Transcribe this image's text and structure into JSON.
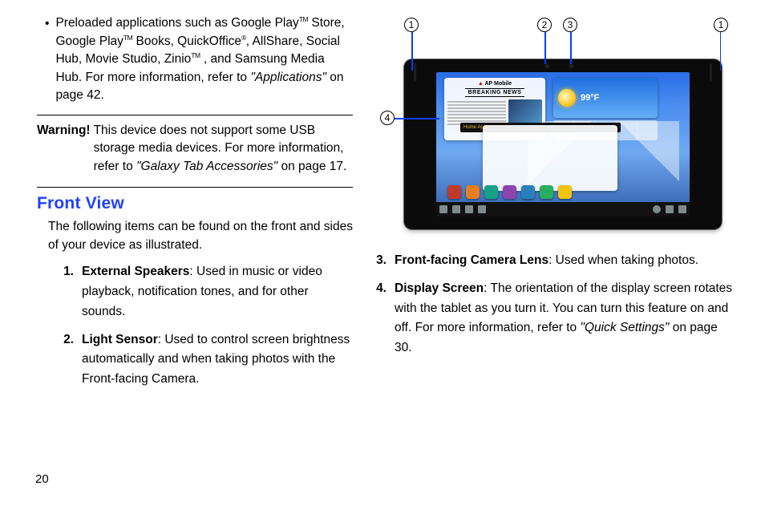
{
  "page_number": "20",
  "bullet": {
    "prefix": "Preloaded applications such as Google Play",
    "tm1": "TM",
    "mid1": " Store, Google Play",
    "tm2": "TM",
    "mid2": " Books, QuickOffice",
    "reg": "®",
    "mid3": ", AllShare, Social Hub, Movie Studio, Zinio",
    "tm3": "TM",
    "suffix": " , and Samsung Media Hub. For more information, refer to ",
    "ref_quote": "\"Applications\"",
    "ref_after": "  on page 42."
  },
  "warning": {
    "label": "Warning!",
    "line": "This device does not support some USB storage media devices. For more information, refer to ",
    "ref_quote": "\"Galaxy Tab Accessories\"",
    "ref_after": "  on page 17."
  },
  "heading": "Front View",
  "intro": "The following items can be found on the front and sides of your device as illustrated.",
  "items": [
    {
      "num": "1.",
      "key": "External Speakers",
      "body": ": Used in music or video playback, notification tones, and for other sounds."
    },
    {
      "num": "2.",
      "key": "Light Sensor",
      "body": ": Used to control screen brightness automatically and when taking photos with the Front-facing Camera."
    },
    {
      "num": "3.",
      "key": "Front-facing Camera Lens",
      "body": ": Used when taking photos."
    },
    {
      "num": "4.",
      "key": "Display Screen",
      "body": ": The orientation of the display screen rotates with the tablet as you turn it. You can turn this feature on and off. For more information, refer to ",
      "ref_quote": "\"Quick Settings\"",
      "ref_after": "  on page 30."
    }
  ],
  "diagram": {
    "callouts": {
      "c1": "1",
      "c2": "2",
      "c3": "3",
      "c4": "4",
      "c1b": "1"
    },
    "news_logo": "AP Mobile",
    "news_headline": "BREAKING NEWS",
    "weather_temp": "99°F",
    "apps_label": "Home Apps"
  }
}
